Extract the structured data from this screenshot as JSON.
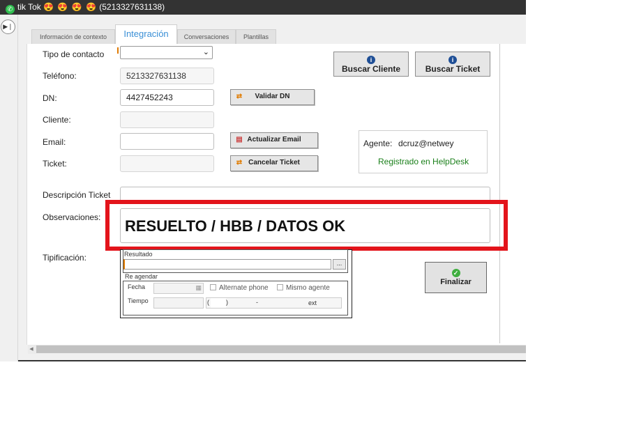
{
  "titlebar": {
    "app_icon": "whatsapp-icon",
    "title": "tik Tok",
    "emojis": "😍 😍 😍 😍",
    "phone": "(5213327631138)"
  },
  "tabs": [
    {
      "label": "Información de contexto"
    },
    {
      "label": "Integración"
    },
    {
      "label": "Conversaciones"
    },
    {
      "label": "Plantillas"
    }
  ],
  "form": {
    "tipo_contacto_label": "Tipo de contacto",
    "telefono_label": "Teléfono:",
    "telefono_value": "5213327631138",
    "dn_label": "DN:",
    "dn_value": "4427452243",
    "cliente_label": "Cliente:",
    "email_label": "Email:",
    "ticket_label": "Ticket:",
    "descripcion_label": "Descripción Ticket",
    "observaciones_label": "Observaciones:",
    "observaciones_value": "RESUELTO / HBB / DATOS OK",
    "tipificacion_label": "Tipificación:"
  },
  "buttons": {
    "validar_dn": "Validar DN",
    "actualizar_email": "Actualizar Email",
    "cancelar_ticket": "Cancelar Ticket",
    "buscar_cliente": "Buscar Cliente",
    "buscar_ticket": "Buscar Ticket",
    "finalizar": "Finalizar",
    "ellipsis": "..."
  },
  "agent": {
    "label": "Agente:",
    "value": "dcruz@netwey",
    "status": "Registrado en HelpDesk",
    "status_color": "#1a7f1a"
  },
  "tipificacion": {
    "resultado_label": "Resultado",
    "reagendar_label": "Re agendar",
    "fecha_label": "Fecha",
    "tiempo_label": "Tiempo",
    "alternate_phone_label": "Alternate phone",
    "mismo_agente_label": "Mismo agente",
    "phone_open": "(",
    "phone_close": ")",
    "phone_dash": "-",
    "phone_ext": "ext"
  },
  "colors": {
    "highlight": "#e3141b",
    "active_tab": "#3a8fd6"
  }
}
